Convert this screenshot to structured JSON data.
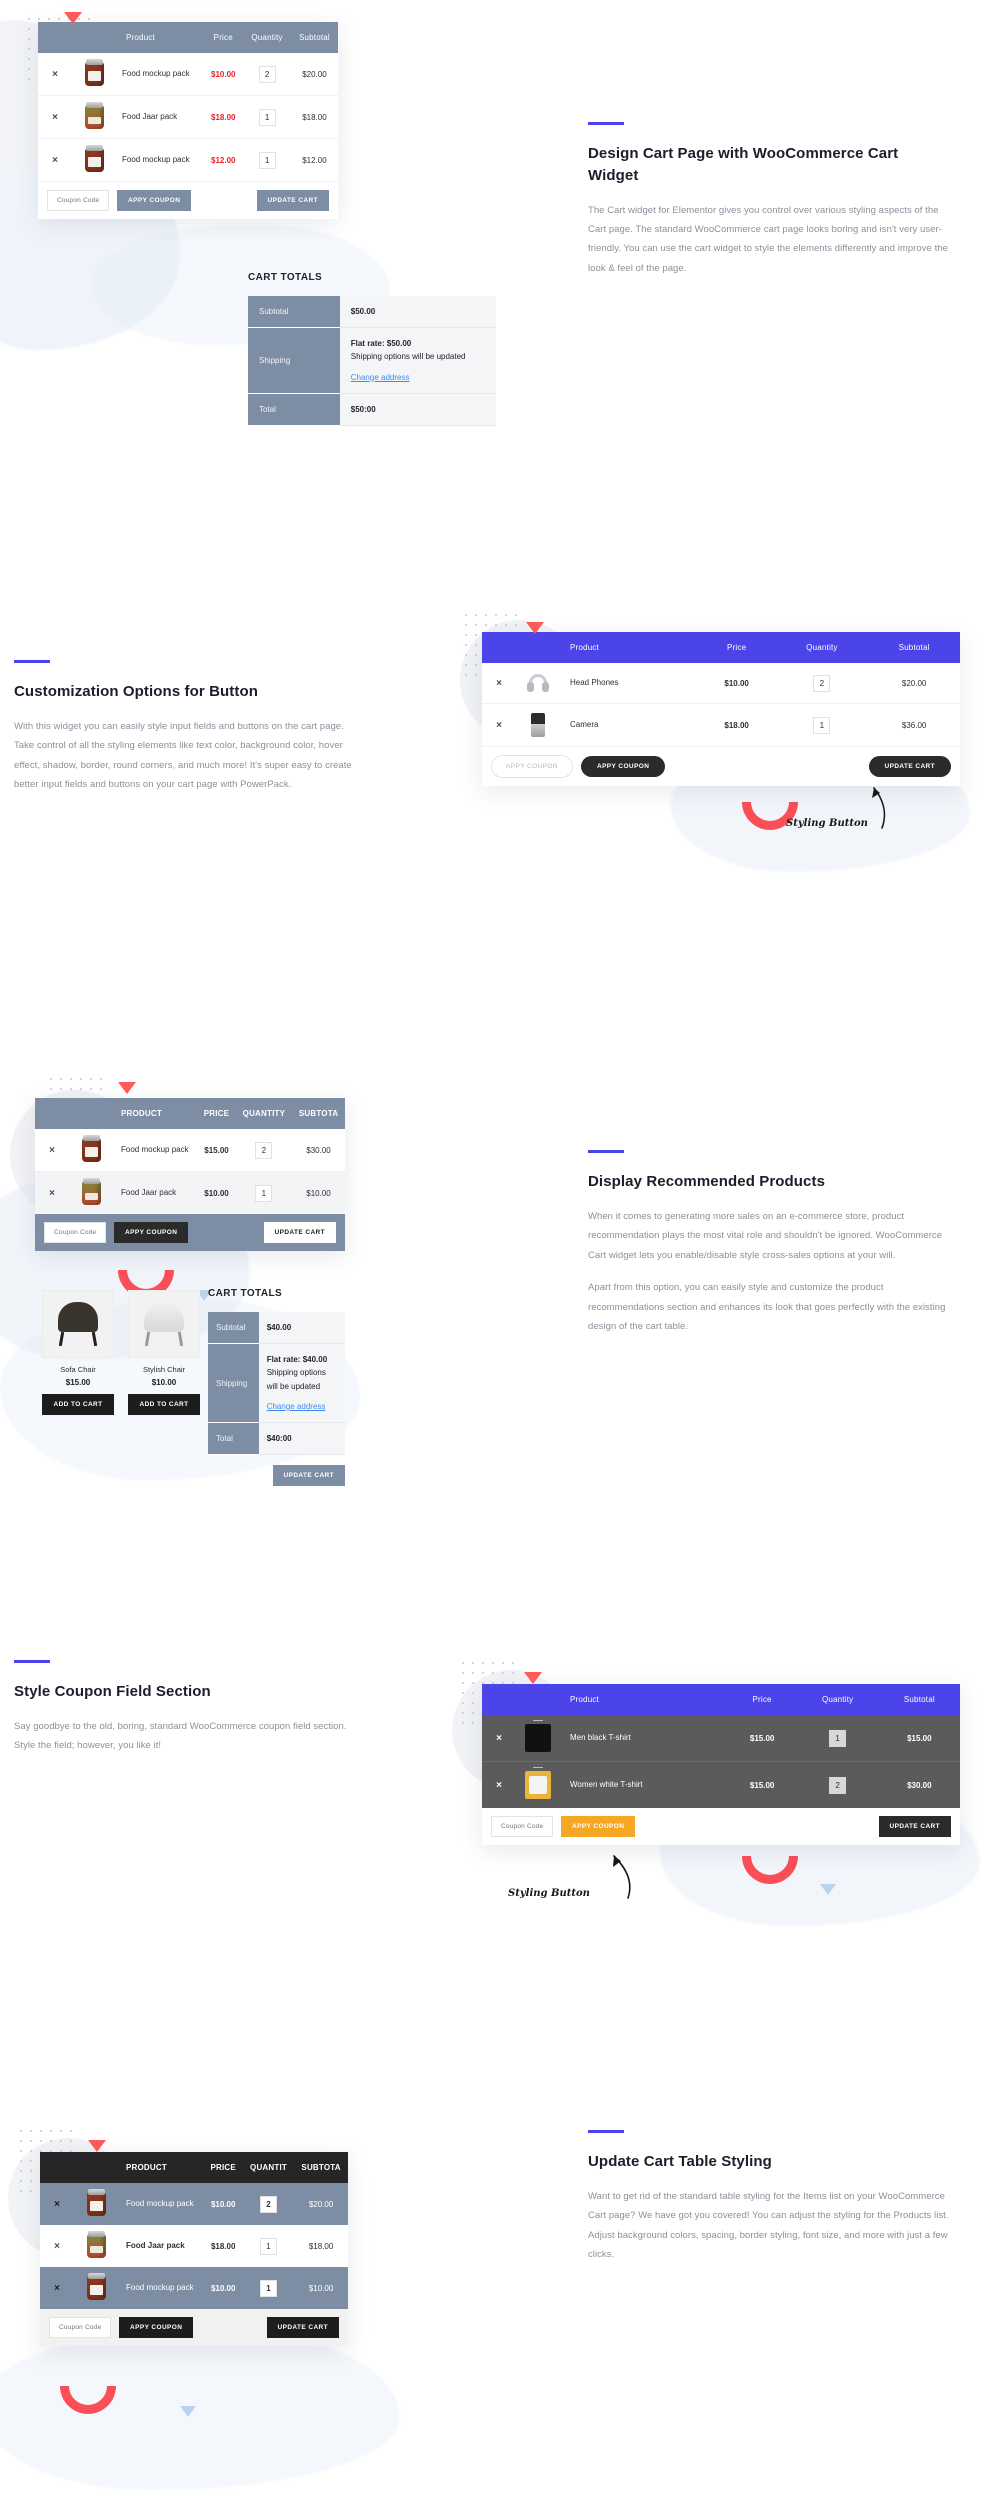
{
  "theme": {
    "accent": "#4b44e8",
    "slate": "#7d8da3",
    "dark": "#262626",
    "orange": "#f5a623",
    "red": "#e8232a",
    "link": "#3f8bf0"
  },
  "common": {
    "remove_icon": "×",
    "coupon_placeholder": "Coupon Code",
    "apply_coupon": "APPY COUPON",
    "update_cart": "UPDATE CART",
    "cart_totals_title": "CART TOTALS",
    "subtotal_label": "Subtotal",
    "shipping_label": "Shipping",
    "total_label": "Total",
    "change_address": "Change address",
    "shipping_note": "Shipping options will be updated",
    "add_to_cart": "ADD TO CART",
    "styling_button_note": "Styling Button"
  },
  "sections": [
    {
      "id": "design-cart-page",
      "heading": "Design Cart Page with WooCommerce Cart Widget",
      "paragraphs": [
        "The Cart widget for Elementor gives you control over various styling aspects of the Cart page. The standard WooCommerce cart page looks boring and isn't very user-friendly. You can use the cart widget to style the elements differently and improve the look & feel of the page."
      ],
      "table": {
        "headers": [
          "",
          "",
          "Product",
          "Price",
          "Quantity",
          "Subtotal"
        ],
        "rows": [
          {
            "product": "Food mockup pack",
            "price": "$10.00",
            "qty": "2",
            "subtotal": "$20.00",
            "thumb": "jar-red"
          },
          {
            "product": "Food Jaar pack",
            "price": "$18.00",
            "qty": "1",
            "subtotal": "$18.00",
            "thumb": "jar-green"
          },
          {
            "product": "Food mockup pack",
            "price": "$12.00",
            "qty": "1",
            "subtotal": "$12.00",
            "thumb": "jar-red"
          }
        ]
      },
      "totals": {
        "subtotal": "$50.00",
        "shipping_rate": "Flat rate: $50.00",
        "total": "$50:00"
      }
    },
    {
      "id": "customization-options",
      "heading": "Customization Options for Button",
      "paragraphs": [
        "With this widget you can easily style input fields and buttons on the cart page. Take control of all the styling elements like text color, background color, hover effect, shadow, border, round corners, and much more! It's super easy to create better input fields and buttons on your cart page with PowerPack."
      ],
      "table": {
        "headers": [
          "",
          "",
          "Product",
          "Price",
          "Quantity",
          "Subtotal"
        ],
        "rows": [
          {
            "product": "Head Phones",
            "price": "$10.00",
            "qty": "2",
            "subtotal": "$20.00",
            "thumb": "headphone"
          },
          {
            "product": "Camera",
            "price": "$18.00",
            "qty": "1",
            "subtotal": "$36.00",
            "thumb": "camera"
          }
        ]
      }
    },
    {
      "id": "display-recommended",
      "heading": "Display Recommended Products",
      "paragraphs": [
        "When it comes to generating more sales on an e-commerce store, product recommendation plays the most vital role and shouldn't be ignored. WooCommerce Cart widget lets you enable/disable style cross-sales options at your will.",
        "Apart from this option, you can easily style and customize the product recommendations section and enhances its look that goes perfectly with the existing design of the cart table."
      ],
      "table": {
        "headers": [
          "",
          "",
          "PRODUCT",
          "PRICE",
          "QUANTITY",
          "SUBTOTA"
        ],
        "rows": [
          {
            "product": "Food mockup pack",
            "price": "$15.00",
            "qty": "2",
            "subtotal": "$30.00",
            "thumb": "jar-red"
          },
          {
            "product": "Food Jaar pack",
            "price": "$10.00",
            "qty": "1",
            "subtotal": "$10.00",
            "thumb": "jar-green"
          }
        ]
      },
      "recommended": [
        {
          "name": "Sofa Chair",
          "price": "$15.00",
          "thumb": "chair-dark"
        },
        {
          "name": "Stylish Chair",
          "price": "$10.00",
          "thumb": "chair-white"
        }
      ],
      "totals": {
        "subtotal": "$40.00",
        "shipping_rate": "Flat rate: $40.00",
        "total": "$40:00"
      }
    },
    {
      "id": "style-coupon-field",
      "heading": "Style Coupon Field Section",
      "paragraphs": [
        "Say goodbye to the old, boring, standard WooCommerce coupon field section. Style the field; however, you like it!"
      ],
      "table": {
        "headers": [
          "",
          "",
          "Product",
          "Price",
          "Quantity",
          "Subtotal"
        ],
        "rows": [
          {
            "product": "Men black T-shirt",
            "price": "$15.00",
            "qty": "1",
            "subtotal": "$15.00",
            "thumb": "tshirt-black"
          },
          {
            "product": "Women white T-shirt",
            "price": "$15.00",
            "qty": "2",
            "subtotal": "$30.00",
            "thumb": "tshirt-white"
          }
        ]
      }
    },
    {
      "id": "update-cart-table",
      "heading": "Update Cart Table Styling",
      "paragraphs": [
        "Want to get rid of the standard table styling for the Items list on your WooCommerce Cart page? We have got you covered! You can adjust the styling for the Products list. Adjust background colors, spacing, border styling, font size, and more with just a few clicks."
      ],
      "table": {
        "headers": [
          "",
          "",
          "PRODUCT",
          "PRICE",
          "QUANTIT",
          "SUBTOTA"
        ],
        "rows": [
          {
            "product": "Food mockup pack",
            "price": "$10.00",
            "qty": "2",
            "subtotal": "$20.00",
            "thumb": "jar-red"
          },
          {
            "product": "Food Jaar pack",
            "price": "$18.00",
            "qty": "1",
            "subtotal": "$18.00",
            "thumb": "jar-green"
          },
          {
            "product": "Food mockup pack",
            "price": "$10.00",
            "qty": "1",
            "subtotal": "$10.00",
            "thumb": "jar-red"
          }
        ]
      }
    }
  ]
}
